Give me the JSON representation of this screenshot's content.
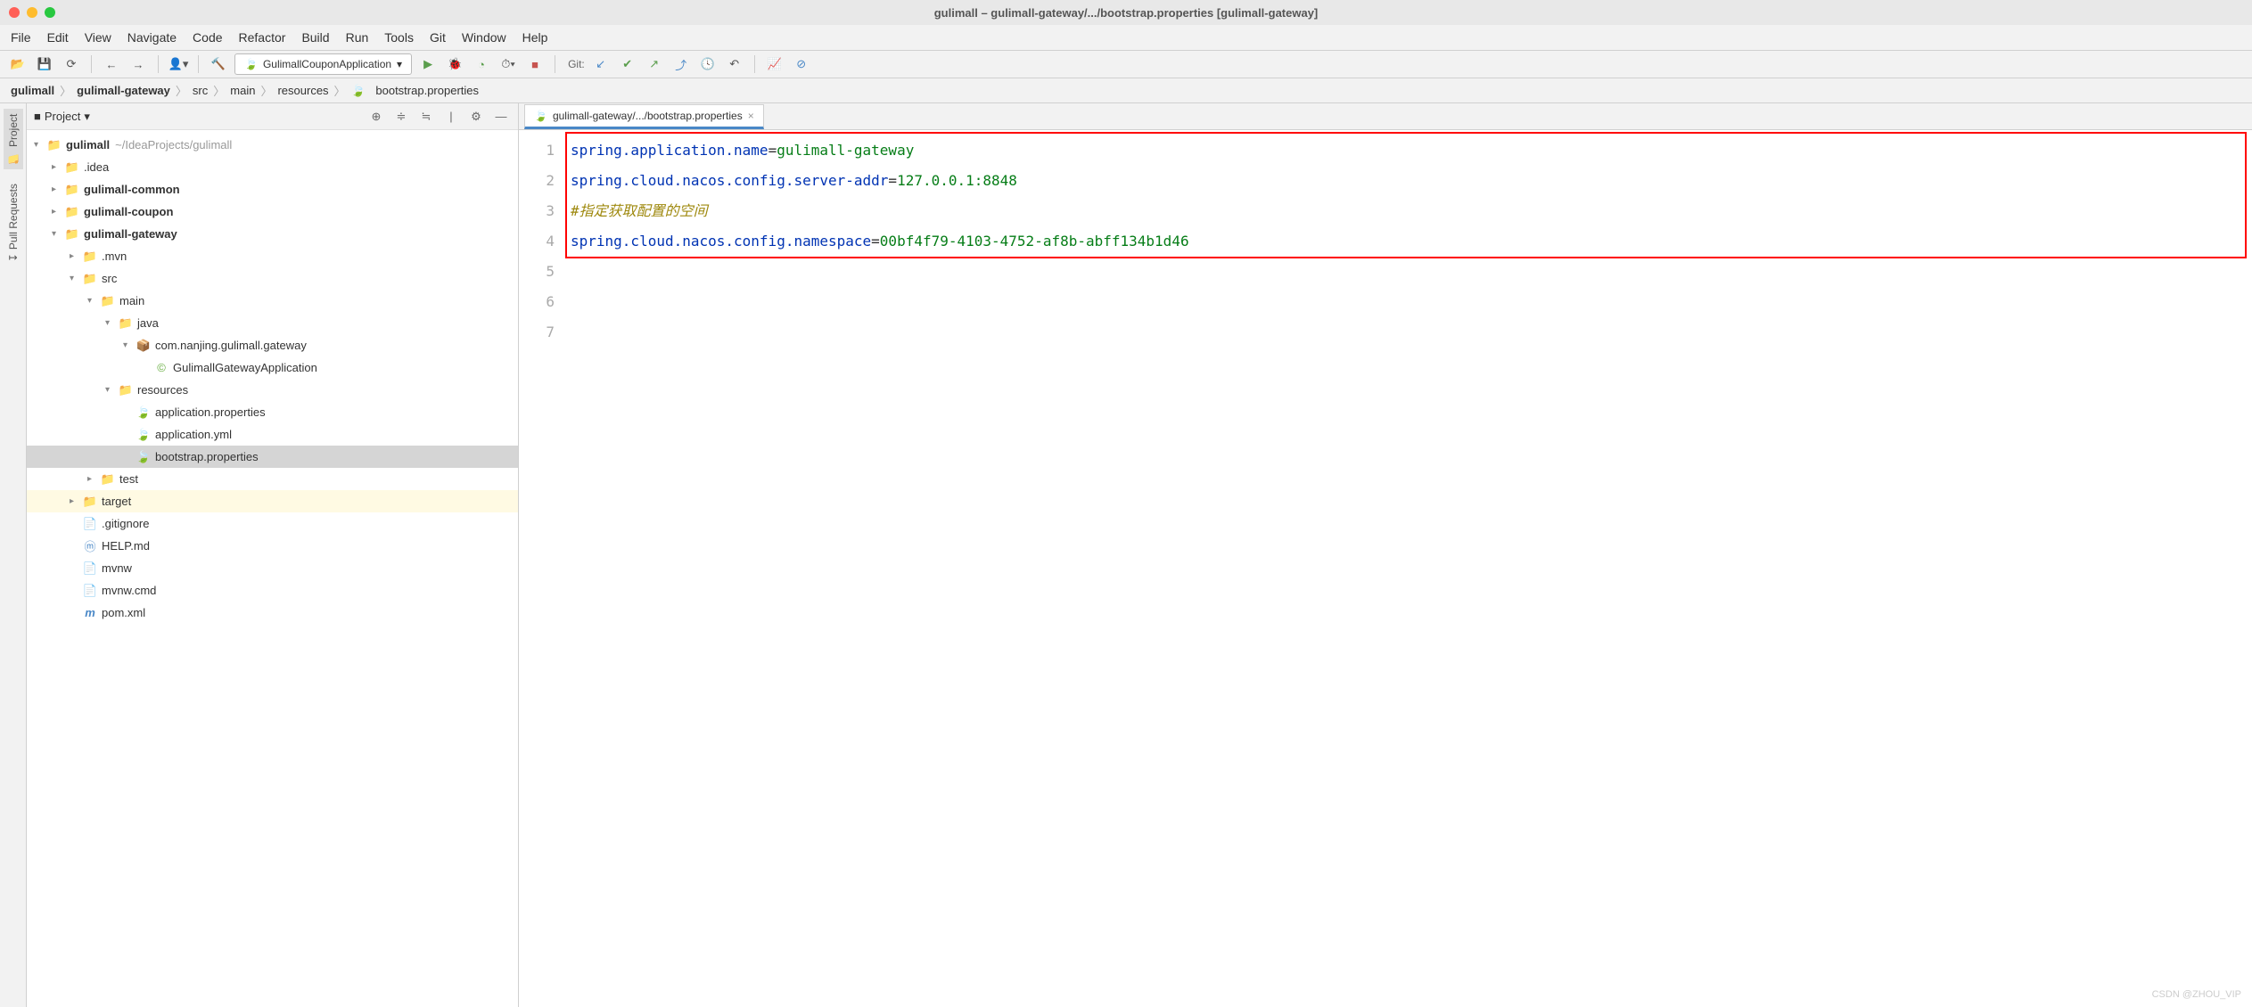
{
  "window": {
    "title": "gulimall – gulimall-gateway/.../bootstrap.properties [gulimall-gateway]"
  },
  "menu": [
    "File",
    "Edit",
    "View",
    "Navigate",
    "Code",
    "Refactor",
    "Build",
    "Run",
    "Tools",
    "Git",
    "Window",
    "Help"
  ],
  "runConfig": "GulimallCouponApplication",
  "toolbar": {
    "gitLabel": "Git:"
  },
  "breadcrumb": [
    "gulimall",
    "gulimall-gateway",
    "src",
    "main",
    "resources",
    "bootstrap.properties"
  ],
  "sidebar": {
    "title": "Project",
    "gutterTabs": [
      "Project",
      "Pull Requests"
    ]
  },
  "tree": {
    "root": "gulimall",
    "rootPath": "~/IdeaProjects/gulimall",
    "n_idea": ".idea",
    "n_common": "gulimall-common",
    "n_coupon": "gulimall-coupon",
    "n_gateway": "gulimall-gateway",
    "n_mvn": ".mvn",
    "n_src": "src",
    "n_main": "main",
    "n_java": "java",
    "n_pkg": "com.nanjing.gulimall.gateway",
    "n_app": "GulimallGatewayApplication",
    "n_res": "resources",
    "n_appprop": "application.properties",
    "n_appyml": "application.yml",
    "n_boot": "bootstrap.properties",
    "n_test": "test",
    "n_target": "target",
    "n_gitignore": ".gitignore",
    "n_help": "HELP.md",
    "n_mvnw": "mvnw",
    "n_mvnwcmd": "mvnw.cmd",
    "n_pom": "pom.xml"
  },
  "tab": {
    "label": "gulimall-gateway/.../bootstrap.properties"
  },
  "code": {
    "lineNumbers": [
      "1",
      "2",
      "3",
      "4",
      "5",
      "6",
      "7"
    ],
    "l1k": "spring.application.name",
    "l1v": "gulimall-gateway",
    "l2k": "spring.cloud.nacos.config.server-addr",
    "l2v": "127.0.0.1:8848",
    "l3": "#指定获取配置的空间",
    "l4k": "spring.cloud.nacos.config.namespace",
    "l4v": "00bf4f79-4103-4752-af8b-abff134b1d46"
  },
  "watermark": "CSDN @ZHOU_VIP"
}
